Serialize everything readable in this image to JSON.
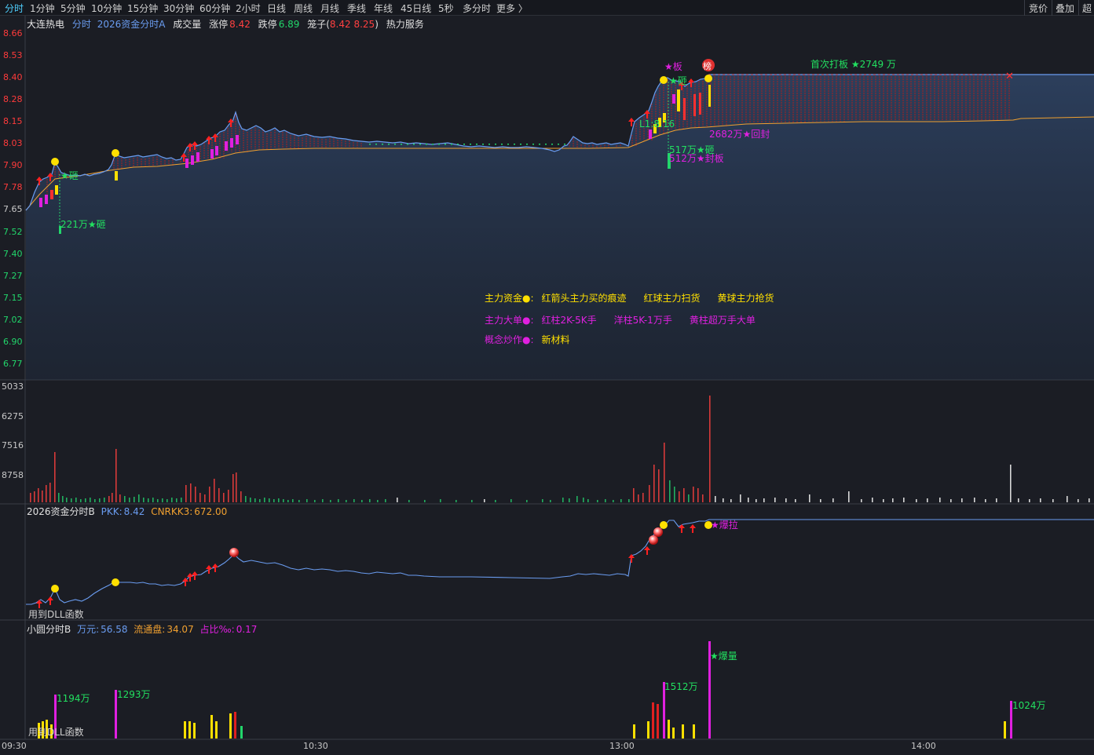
{
  "toolbar": {
    "tabs": [
      "分时",
      "1分钟",
      "5分钟",
      "10分钟",
      "15分钟",
      "30分钟",
      "60分钟",
      "2小时",
      "日线",
      "周线",
      "月线",
      "季线",
      "年线",
      "45日线",
      "5秒",
      "多分时",
      "更多 〉"
    ],
    "right_buttons": [
      "竞价",
      "叠加",
      "超"
    ]
  },
  "header": {
    "stock_name": "大连热电",
    "mode": "分时",
    "indicator": "2026资金分时A",
    "volume_label": "成交量",
    "limit_up_label": "涨停",
    "limit_up_value": "8.42",
    "limit_down_label": "跌停",
    "limit_down_value": "6.89",
    "cage_label": "笼子(",
    "cage_values": "8.42 8.25",
    "cage_close": ")",
    "service": "热力服务"
  },
  "price_axis": [
    "8.66",
    "8.53",
    "8.40",
    "8.28",
    "8.15",
    "8.03",
    "7.90",
    "7.78",
    "7.65",
    "7.52",
    "7.40",
    "7.27",
    "7.15",
    "7.02",
    "6.90",
    "6.77"
  ],
  "volume_axis": [
    "5033",
    "6275",
    "7516",
    "8758"
  ],
  "time_axis": [
    "09:30",
    "10:30",
    "13:00",
    "14:00"
  ],
  "annotations": {
    "first_board": "首次打板 ★2749 万",
    "board_star": "★板",
    "smash1": "★砸",
    "smash2": "★砸",
    "vol221": "221万★砸",
    "l1": "L1:8.16",
    "vol517": "517万★砸",
    "vol512": "512万★封板",
    "vol2682": "2682万★回封",
    "bang": "榜"
  },
  "legend": {
    "row1": {
      "label": "主力资金●:",
      "items": [
        "红箭头主力买的痕迹",
        "红球主力扫货",
        "黄球主力抢货"
      ]
    },
    "row2": {
      "label": "主力大单●:",
      "items": [
        "红柱2K-5K手",
        "洋柱5K-1万手",
        "黄柱超万手大单"
      ]
    },
    "row3": {
      "label": "概念炒作●:",
      "items": [
        "新材料"
      ]
    }
  },
  "panel2": {
    "title": "2026资金分时B",
    "pkk_label": "PKK:",
    "pkk_value": "8.42",
    "cnrkk_label": "CNRKK3:",
    "cnrkk_value": "672.00",
    "explode": "★爆拉",
    "dll": "用到DLL函数"
  },
  "panel3": {
    "title": "小圆分时B",
    "wan_label": "万元:",
    "wan_value": "56.58",
    "float_label": "流通盘:",
    "float_value": "34.07",
    "ratio_label": "占比‰:",
    "ratio_value": "0.17",
    "labels": [
      "1194万",
      "1293万",
      "1512万",
      "★爆量",
      "1024万"
    ],
    "dll": "用到DLL函数"
  },
  "colors": {
    "up": "#ff3b3b",
    "down": "#22d66b",
    "price_line": "#6a9cf0",
    "avg_line": "#f0a030",
    "yellow": "#ffe000",
    "magenta": "#e020e0",
    "green_text": "#22e060"
  }
}
